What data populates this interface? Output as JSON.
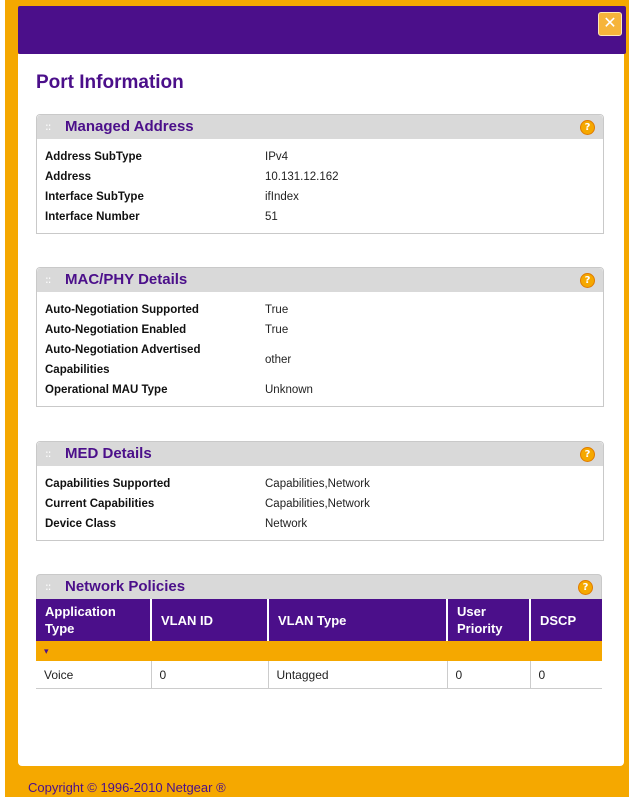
{
  "window": {
    "close_glyph": "✕"
  },
  "page": {
    "title": "Port Information"
  },
  "icons": {
    "section_handle": "::",
    "help": "?"
  },
  "managed_address": {
    "title": "Managed Address",
    "rows": [
      {
        "key": "Address SubType",
        "value": "IPv4"
      },
      {
        "key": "Address",
        "value": "10.131.12.162"
      },
      {
        "key": "Interface SubType",
        "value": "ifIndex"
      },
      {
        "key": "Interface Number",
        "value": "51"
      }
    ]
  },
  "mac_phy": {
    "title": "MAC/PHY Details",
    "rows": [
      {
        "key": "Auto-Negotiation Supported",
        "value": "True"
      },
      {
        "key": "Auto-Negotiation Enabled",
        "value": "True"
      },
      {
        "key": "Auto-Negotiation Advertised Capabilities",
        "value": "other"
      },
      {
        "key": "Operational MAU Type",
        "value": "Unknown"
      }
    ]
  },
  "med": {
    "title": "MED Details",
    "rows": [
      {
        "key": "Capabilities Supported",
        "value": "Capabilities,Network"
      },
      {
        "key": "Current Capabilities",
        "value": "Capabilities,Network"
      },
      {
        "key": "Device Class",
        "value": "Network"
      }
    ]
  },
  "network_policies": {
    "title": "Network Policies",
    "columns": [
      "Application Type",
      "VLAN ID",
      "VLAN Type",
      "User Priority",
      "DSCP"
    ],
    "expand_glyph": "▾",
    "rows": [
      [
        "Voice",
        "0",
        "Untagged",
        "0",
        "0"
      ]
    ]
  },
  "footer": {
    "copyright": "Copyright © 1996-2010 Netgear ®"
  }
}
